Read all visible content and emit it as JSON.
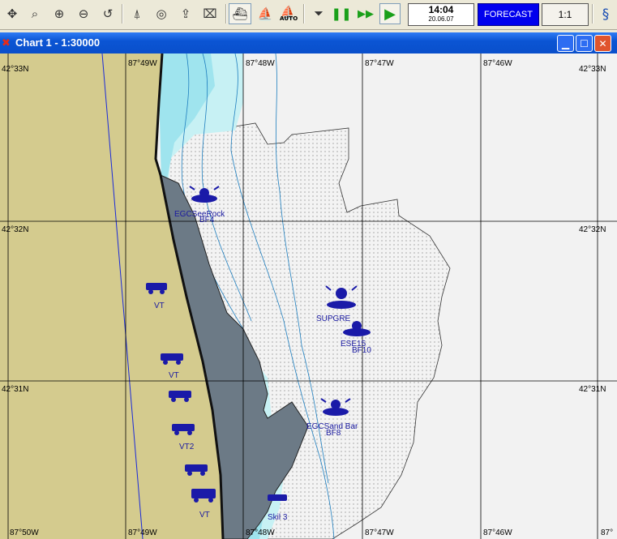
{
  "toolbar": {
    "auto_label": "AUTO",
    "clock_time": "14:04",
    "clock_date": "20.06.07",
    "forecast_label": "FORECAST",
    "scale_ratio": "1:1",
    "icons": [
      "move-icon",
      "zoom-window-icon",
      "zoom-in-icon",
      "zoom-out-icon",
      "undo-icon",
      "route-icon",
      "target-icon",
      "load-icon",
      "delete-icon",
      "ship-track-icon",
      "vessel-icon",
      "auto-vessel-icon",
      "stop-icon",
      "pause-icon",
      "fast-forward-icon",
      "play-icon",
      "refresh-icon"
    ],
    "colors": {
      "forecast_bg": "#0000ee",
      "play": "#1aa01a",
      "pause": "#1aa01a"
    }
  },
  "window": {
    "title": "Chart 1 - 1:30000",
    "controls": [
      "minimize-icon",
      "maximize-icon",
      "close-icon"
    ]
  },
  "chart": {
    "lat_labels": [
      "42°33N",
      "42°32N",
      "42°31N"
    ],
    "lon_labels_top": [
      "87°49W",
      "87°48W",
      "87°47W",
      "87°46W"
    ],
    "lon_labels_bottom": [
      "87°50W",
      "87°49W",
      "87°48W",
      "87°47W",
      "87°46W",
      "87°"
    ],
    "markers": [
      {
        "code": "BF4",
        "name": "EGCSeeRock"
      },
      {
        "code": "",
        "name": "SUPGRE"
      },
      {
        "code": "BF10",
        "name": "ESE15"
      },
      {
        "code": "BF8",
        "name": "EGCSand Bar"
      },
      {
        "code": "VT",
        "name": ""
      },
      {
        "code": "VT",
        "name": ""
      },
      {
        "code": "VT2",
        "name": ""
      },
      {
        "code": "VT",
        "name": ""
      },
      {
        "code": "Skil 3",
        "name": ""
      }
    ],
    "colors": {
      "land": "#d4cb8e",
      "shore": "#6e7c88",
      "shallow": "#9de3ee",
      "medium": "#c8f0f3",
      "deep": "#f2f2f2",
      "route": "#1a2ad8",
      "markers": "#1a1aa8"
    }
  }
}
